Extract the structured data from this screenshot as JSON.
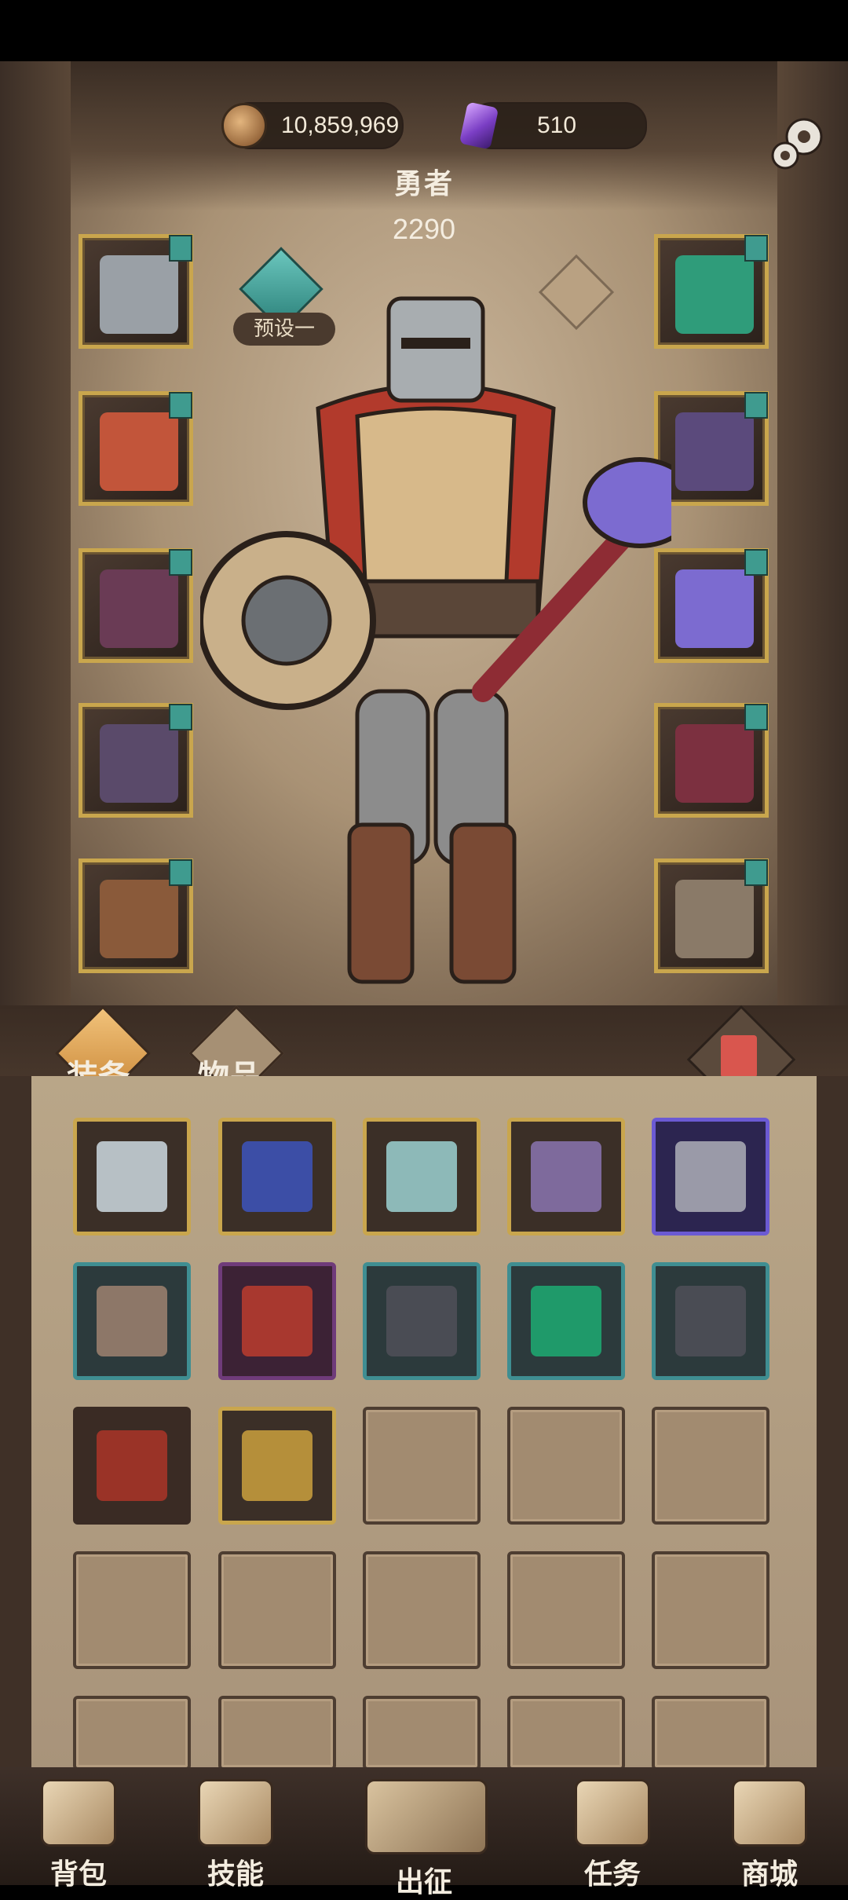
{
  "currency": {
    "coins": "10,859,969",
    "gems": "510"
  },
  "hero": {
    "name": "勇者",
    "power": "2290"
  },
  "preset": {
    "label": "预设一"
  },
  "left_slots": [
    {
      "icon": "helmet-icon",
      "color": "#9aa0a6"
    },
    {
      "icon": "chest-armor-icon",
      "color": "#c2553a"
    },
    {
      "icon": "gauntlet-icon",
      "color": "#6a3b55"
    },
    {
      "icon": "leg-armor-icon",
      "color": "#5a4a6a"
    },
    {
      "icon": "boots-icon",
      "color": "#8a5a3a"
    }
  ],
  "right_slots": [
    {
      "icon": "amulet-icon",
      "color": "#2f9c7a"
    },
    {
      "icon": "shoulder-icon",
      "color": "#5b4a7c"
    },
    {
      "icon": "ring-icon",
      "color": "#7c6bd0"
    },
    {
      "icon": "weapon-icon",
      "color": "#7c3040"
    },
    {
      "icon": "shield-icon",
      "color": "#8a7a68"
    }
  ],
  "tabs": {
    "equipment": "装备",
    "items": "物品"
  },
  "inventory": [
    {
      "border": "gold",
      "icon": "dagger-icon",
      "color": "#b7c0c5"
    },
    {
      "border": "gold",
      "icon": "amulet-icon",
      "color": "#3c4ea6"
    },
    {
      "border": "gold",
      "icon": "amulet-icon",
      "color": "#8db9b8"
    },
    {
      "border": "gold",
      "icon": "shoulder-icon",
      "color": "#7e6a9c"
    },
    {
      "border": "violet",
      "icon": "gauntlet-icon",
      "color": "#9a9aa8"
    },
    {
      "border": "teal",
      "icon": "dagger-icon",
      "color": "#8d7768"
    },
    {
      "border": "purple",
      "icon": "hood-icon",
      "color": "#a8382f"
    },
    {
      "border": "teal",
      "icon": "boots-icon",
      "color": "#4a4c54"
    },
    {
      "border": "teal",
      "icon": "amulet-icon",
      "color": "#1f9a6a"
    },
    {
      "border": "teal",
      "icon": "shoulder-icon",
      "color": "#4a4c54"
    },
    {
      "border": "plain",
      "icon": "boots-icon",
      "color": "#9a3327"
    },
    {
      "border": "gold",
      "icon": "amulet-icon",
      "color": "#b58f3a"
    }
  ],
  "nav": {
    "backpack": "背包",
    "skills": "技能",
    "expedition": "出征",
    "quests": "任务",
    "shop": "商城"
  }
}
